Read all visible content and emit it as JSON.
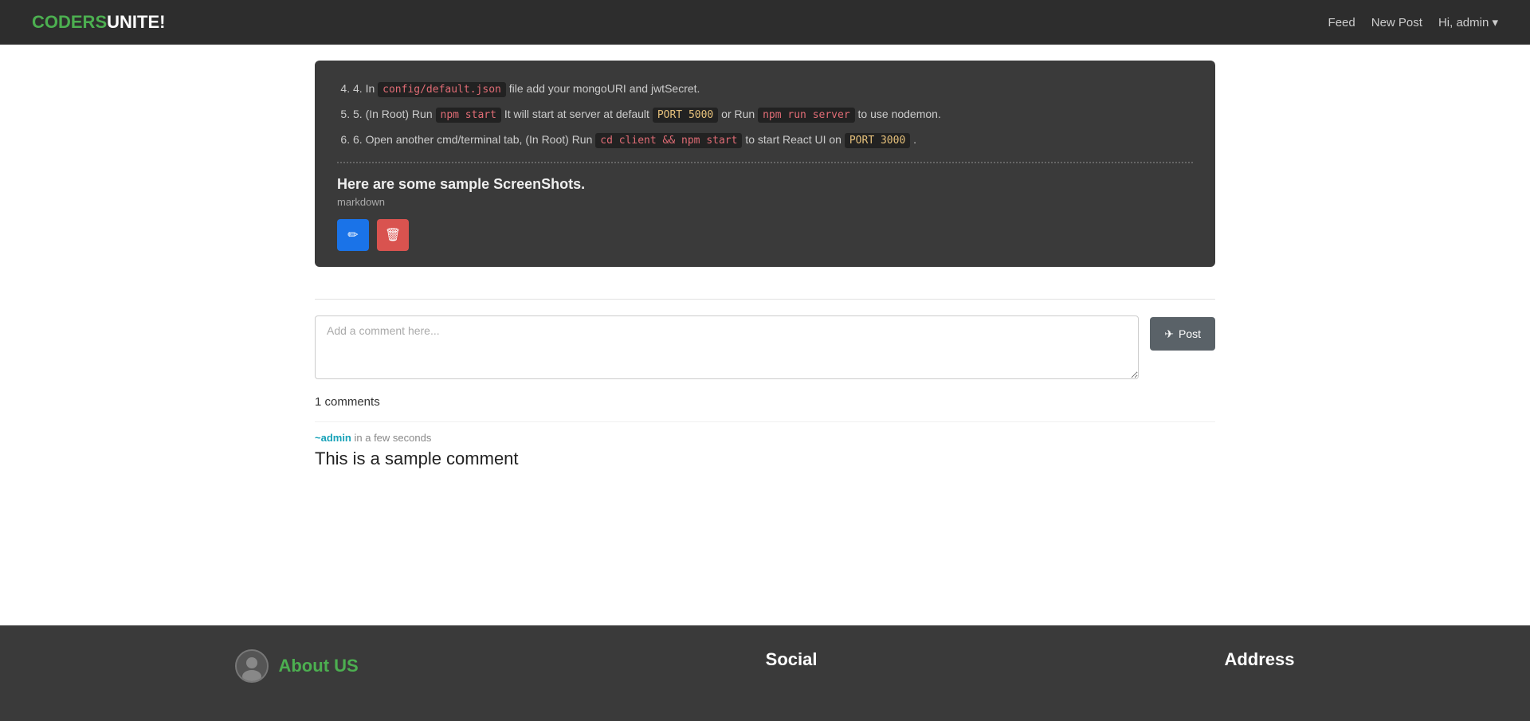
{
  "navbar": {
    "brand_coders": "CODERS",
    "brand_unite": "UNITE!",
    "feed_label": "Feed",
    "new_post_label": "New Post",
    "hi_admin_label": "Hi, admin"
  },
  "post": {
    "step4_prefix": "4. In ",
    "step4_code": "config/default.json",
    "step4_suffix": " file add your mongoURI and jwtSecret.",
    "step5_prefix": "5. (In Root) Run ",
    "step5_code1": "npm start",
    "step5_middle": " It will start at server at default ",
    "step5_port": "PORT 5000",
    "step5_or": " or Run ",
    "step5_code2": "npm run server",
    "step5_suffix": " to use nodemon.",
    "step6_prefix": "6. Open another cmd/terminal tab, (In Root) Run ",
    "step6_code1": "cd client && npm start",
    "step6_middle": " to start React UI on ",
    "step6_port": "PORT 3000",
    "step6_suffix": " .",
    "screenshot_title": "Here are some sample ScreenShots.",
    "screenshot_subtitle": "markdown",
    "edit_btn": "✏",
    "delete_btn": "🗑"
  },
  "comment_section": {
    "textarea_placeholder": "Add a comment here...",
    "post_btn": "Post",
    "comments_count": "1 comments",
    "author_link": "~admin",
    "time": "in a few seconds",
    "comment_text": "This is a sample comment"
  },
  "footer": {
    "about_title": "About US",
    "social_title": "Social",
    "address_title": "Address"
  }
}
